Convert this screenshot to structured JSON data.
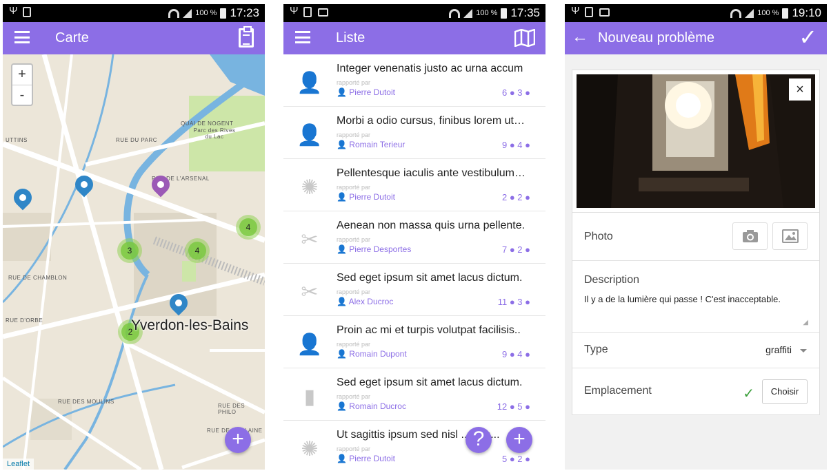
{
  "status": [
    {
      "battery_pct": "100 %",
      "time": "17:23"
    },
    {
      "battery_pct": "100 %",
      "time": "17:35"
    },
    {
      "battery_pct": "100 %",
      "time": "19:10"
    }
  ],
  "map_screen": {
    "title": "Carte",
    "zoom_in": "+",
    "zoom_out": "-",
    "city": "Yverdon-les-Bains",
    "attribution": "Leaflet",
    "clusters": [
      "4",
      "3",
      "4",
      "2"
    ],
    "fab": "+",
    "labels": [
      "RUE DE L'ARSENAL",
      "QUAI DE NOGENT",
      "Parc des Rives du Lac",
      "RUE DU PARC",
      "RUE DE CHAMBLON",
      "RUE D'ORBE",
      "RUE DES MOULINS",
      "RUE DES PHILO",
      "RUE DE LA PLAINE",
      "UTTINS"
    ]
  },
  "list_screen": {
    "title": "Liste",
    "reported_by": "rapporté par",
    "items": [
      {
        "icon": "user-plus-icon",
        "title": "Integer venenatis justo ac urna accum",
        "user": "Pierre Dutoit",
        "counts": "6 ● 3 ●"
      },
      {
        "icon": "user-plus-icon",
        "title": "Morbi a odio cursus, finibus lorem ut…",
        "user": "Romain Terieur",
        "counts": "9 ● 4 ●"
      },
      {
        "icon": "spinner-icon",
        "title": "Pellentesque iaculis ante vestibulum…",
        "user": "Pierre Dutoit",
        "counts": "2 ● 2 ●"
      },
      {
        "icon": "tools-icon",
        "title": "Aenean non massa quis urna pellente.",
        "user": "Pierre Desportes",
        "counts": "7 ● 2 ●"
      },
      {
        "icon": "tools-icon",
        "title": "Sed eget ipsum sit amet lacus dictum.",
        "user": "Alex Ducroc",
        "counts": "11 ● 3 ●"
      },
      {
        "icon": "user-plus-icon",
        "title": "Proin ac mi et turpis volutpat facilisis..",
        "user": "Romain Dupont",
        "counts": "9 ● 4 ●"
      },
      {
        "icon": "bookmark-icon",
        "title": "Sed eget ipsum sit amet lacus dictum.",
        "user": "Romain Ducroc",
        "counts": "12 ● 5 ●"
      },
      {
        "icon": "spinner-icon",
        "title": "Ut sagittis ipsum sed nisl ... ces...",
        "user": "Pierre Dutoit",
        "counts": "5 ● 2 ●"
      }
    ],
    "help_fab": "?",
    "add_fab": "+"
  },
  "form_screen": {
    "title": "Nouveau problème",
    "close": "×",
    "photo_label": "Photo",
    "description_label": "Description",
    "description_value": "Il y a de la lumière qui passe ! C'est inacceptable.",
    "type_label": "Type",
    "type_value": "graffiti",
    "location_label": "Emplacement",
    "choose_button": "Choisir"
  },
  "colors": {
    "accent": "#8c6ee6",
    "map_water": "#78b4e0",
    "map_park": "#cde6a8",
    "ok": "#3a9e3a"
  }
}
